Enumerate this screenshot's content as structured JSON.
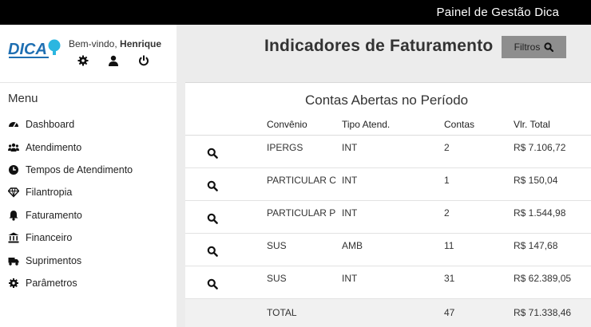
{
  "header": {
    "app_title": "Painel de Gestão Dica"
  },
  "brand": {
    "logo_text": "DICA",
    "logo_color": "#1f6fb2",
    "accent_color": "#2bb6e0"
  },
  "user": {
    "welcome_prefix": "Bem-vindo,",
    "name": "Henrique"
  },
  "user_actions": [
    {
      "icon": "gear-icon"
    },
    {
      "icon": "user-icon"
    },
    {
      "icon": "power-icon"
    }
  ],
  "sidebar": {
    "menu_title": "Menu",
    "items": [
      {
        "label": "Dashboard",
        "icon": "dashboard-icon"
      },
      {
        "label": "Atendimento",
        "icon": "users-icon"
      },
      {
        "label": "Tempos de Atendimento",
        "icon": "clock-icon"
      },
      {
        "label": "Filantropia",
        "icon": "gem-icon"
      },
      {
        "label": "Faturamento",
        "icon": "bell-icon"
      },
      {
        "label": "Financeiro",
        "icon": "bank-icon"
      },
      {
        "label": "Suprimentos",
        "icon": "truck-icon"
      },
      {
        "label": "Parâmetros",
        "icon": "gear-icon"
      }
    ]
  },
  "main": {
    "title": "Indicadores de Faturamento",
    "filter_label": "Filtros",
    "filter_color": "#8e8e8e"
  },
  "panel": {
    "title": "Contas Abertas no Período",
    "columns": [
      "Convênio",
      "Tipo Atend.",
      "Contas",
      "Vlr. Total"
    ],
    "rows": [
      {
        "convenio": "IPERGS",
        "tipo": "INT",
        "contas": "2",
        "valor": "R$ 7.106,72"
      },
      {
        "convenio": "PARTICULAR C",
        "tipo": "INT",
        "contas": "1",
        "valor": "R$ 150,04"
      },
      {
        "convenio": "PARTICULAR P",
        "tipo": "INT",
        "contas": "2",
        "valor": "R$ 1.544,98"
      },
      {
        "convenio": "SUS",
        "tipo": "AMB",
        "contas": "11",
        "valor": "R$ 147,68"
      },
      {
        "convenio": "SUS",
        "tipo": "INT",
        "contas": "31",
        "valor": "R$ 62.389,05"
      }
    ],
    "total": {
      "label": "TOTAL",
      "contas": "47",
      "valor": "R$ 71.338,46"
    }
  }
}
